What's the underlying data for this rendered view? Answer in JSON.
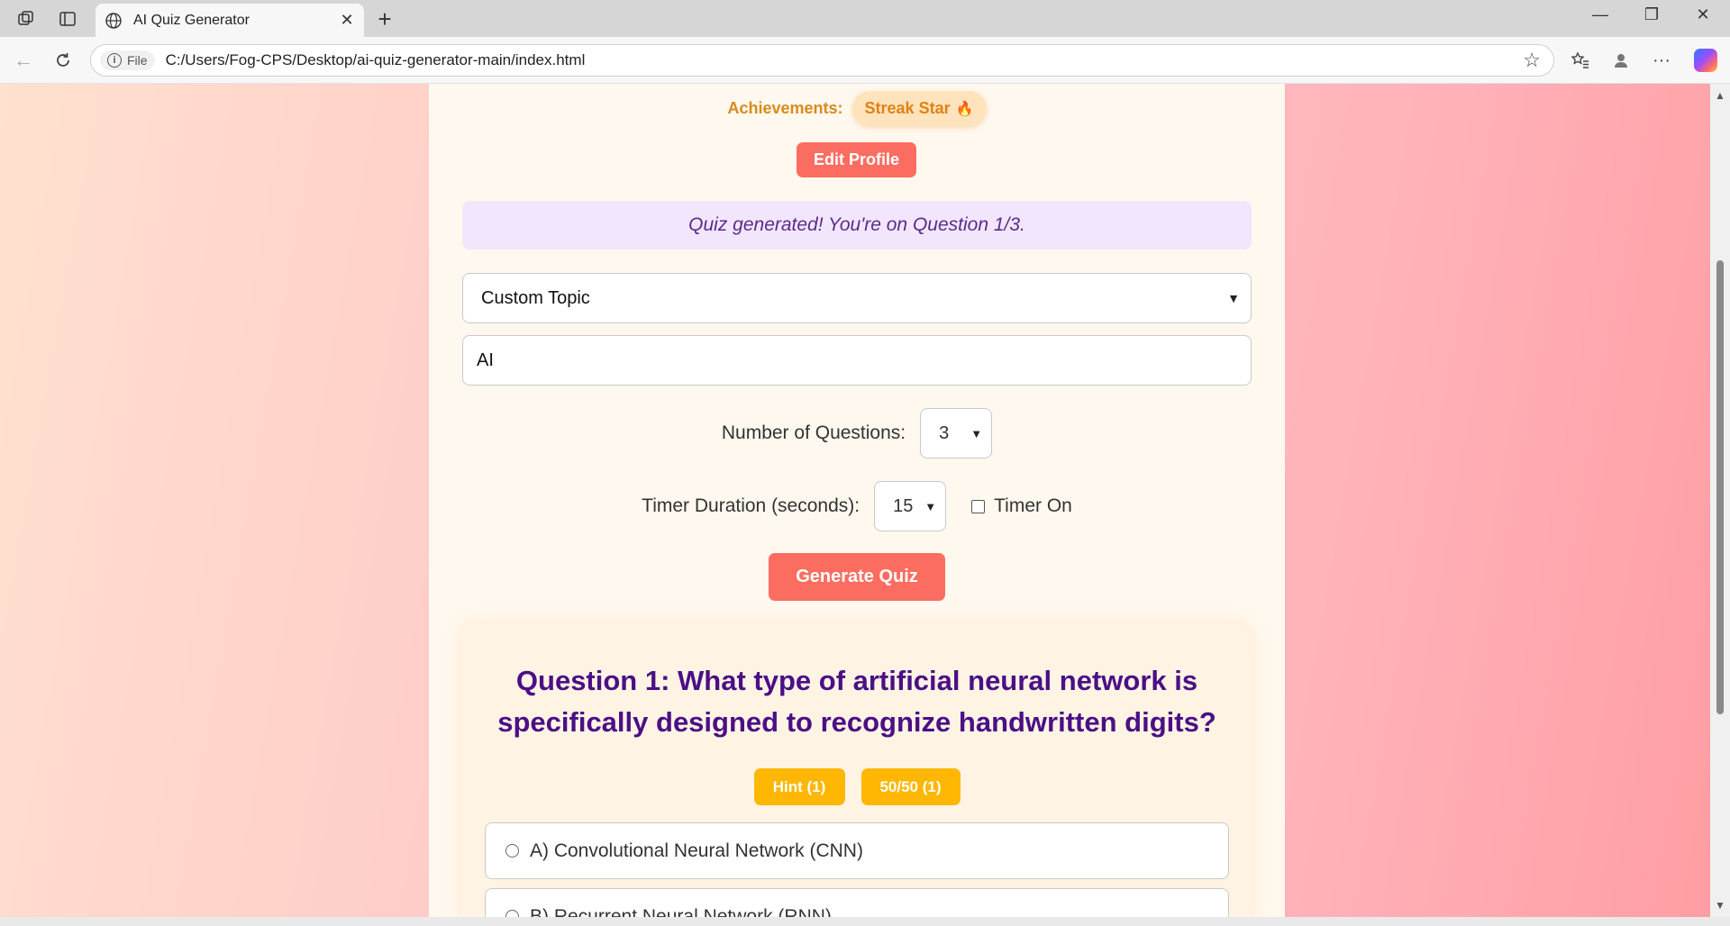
{
  "browser": {
    "tab_title": "AI Quiz Generator",
    "url_scheme": "File",
    "url_path": "C:/Users/Fog-CPS/Desktop/ai-quiz-generator-main/index.html"
  },
  "achievements": {
    "label": "Achievements:",
    "badge": "Streak Star"
  },
  "profile": {
    "edit_label": "Edit Profile"
  },
  "status_message": "Quiz generated! You're on Question 1/3.",
  "form": {
    "topic_select_value": "Custom Topic",
    "topic_input_value": "AI",
    "num_questions_label": "Number of Questions:",
    "num_questions_value": "3",
    "timer_label": "Timer Duration (seconds):",
    "timer_value": "15",
    "timer_toggle_label": "Timer On",
    "generate_label": "Generate Quiz"
  },
  "question": {
    "title": "Question 1: What type of artificial neural network is specifically designed to recognize handwritten digits?",
    "hint_label": "Hint (1)",
    "fifty_label": "50/50 (1)",
    "options": [
      {
        "label": "A) Convolutional Neural Network (CNN)"
      },
      {
        "label": "B) Recurrent Neural Network (RNN)"
      }
    ]
  },
  "colors": {
    "accent_coral": "#fb6d60",
    "accent_amber": "#ffb703",
    "question_purple": "#4b0f86",
    "status_bg": "#f2e6fd"
  }
}
